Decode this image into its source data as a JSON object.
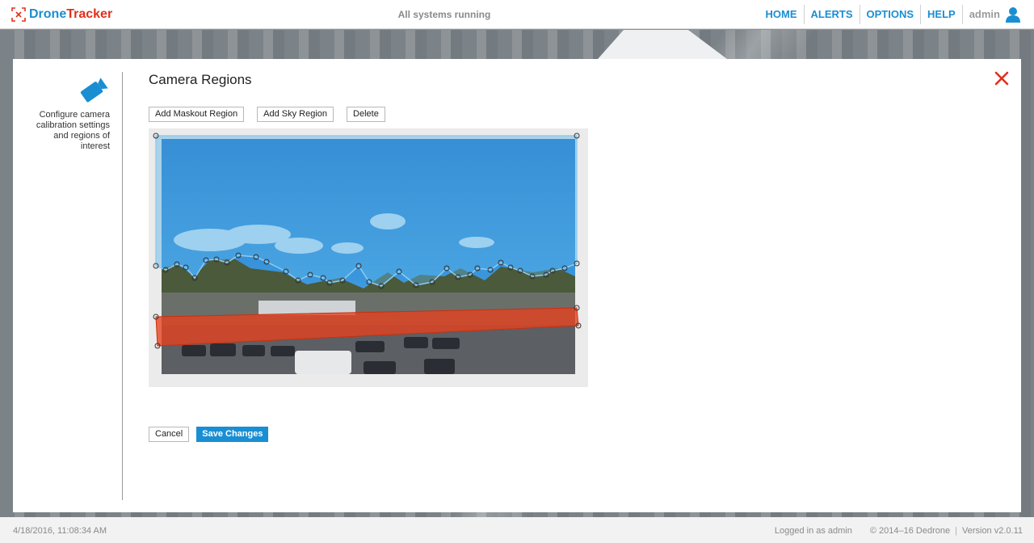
{
  "app": {
    "logo_part1": "Drone",
    "logo_part2": "Tracker",
    "system_status": "All systems running"
  },
  "nav": {
    "items": [
      {
        "label": "HOME"
      },
      {
        "label": "ALERTS"
      },
      {
        "label": "OPTIONS"
      },
      {
        "label": "HELP"
      }
    ],
    "user": "admin"
  },
  "sidebar": {
    "description": "Configure camera calibration settings and regions of interest"
  },
  "page": {
    "title": "Camera Regions"
  },
  "toolbar": {
    "add_maskout_label": "Add Maskout Region",
    "add_sky_label": "Add Sky Region",
    "delete_label": "Delete"
  },
  "actions": {
    "cancel_label": "Cancel",
    "save_label": "Save Changes"
  },
  "footer": {
    "timestamp": "4/18/2016, 11:08:34 AM",
    "logged_in": "Logged in as admin",
    "copyright": "© 2014–16 Dedrone",
    "version": "Version v2.0.11"
  },
  "colors": {
    "brand_blue": "#1a8ed3",
    "brand_red": "#e0301e",
    "sky_region": "#5bb4e6",
    "maskout_region": "#e8401c"
  },
  "icons": {
    "logo": "crosshair-icon",
    "user": "user-icon",
    "sidebar": "camera-icon",
    "close": "close-icon"
  }
}
